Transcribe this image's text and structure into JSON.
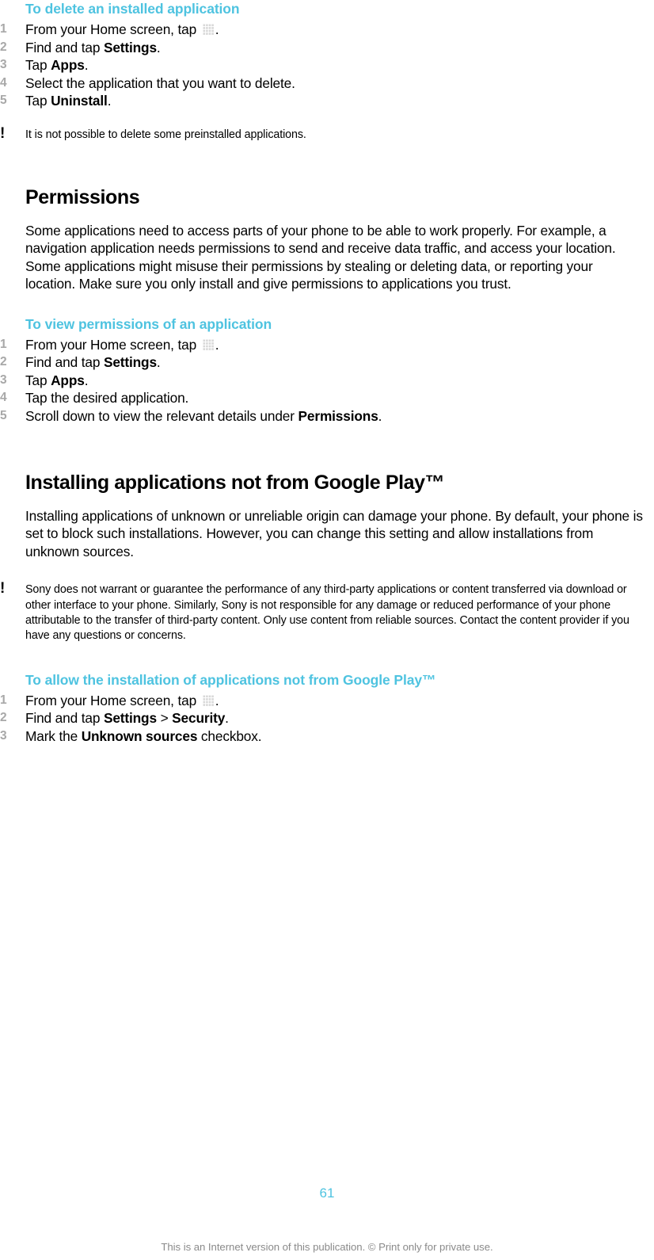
{
  "document": {
    "page_number": "61",
    "footer_note": "This is an Internet version of this publication. © Print only for private use.",
    "accent_color": "#4ec3e0",
    "step_number_color": "#a8a8a8",
    "footer_color": "#8a8a8a"
  },
  "icons": {
    "app_drawer": "app-drawer-grid-icon",
    "warning": "!"
  },
  "sections": {
    "delete_app": {
      "heading": "To delete an installed application",
      "steps": [
        {
          "num": "1",
          "pre": "From your Home screen, tap ",
          "icon": true,
          "post": "."
        },
        {
          "num": "2",
          "pre": "Find and tap ",
          "bold": "Settings",
          "post": "."
        },
        {
          "num": "3",
          "pre": "Tap ",
          "bold": "Apps",
          "post": "."
        },
        {
          "num": "4",
          "pre": "Select the application that you want to delete.",
          "post": ""
        },
        {
          "num": "5",
          "pre": "Tap ",
          "bold": "Uninstall",
          "post": "."
        }
      ],
      "note": "It is not possible to delete some preinstalled applications."
    },
    "permissions": {
      "heading": "Permissions",
      "paragraph": "Some applications need to access parts of your phone to be able to work properly. For example, a navigation application needs permissions to send and receive data traffic, and access your location. Some applications might misuse their permissions by stealing or deleting data, or reporting your location. Make sure you only install and give permissions to applications you trust.",
      "task": {
        "heading": "To view permissions of an application",
        "steps": [
          {
            "num": "1",
            "pre": "From your Home screen, tap ",
            "icon": true,
            "post": "."
          },
          {
            "num": "2",
            "pre": "Find and tap ",
            "bold": "Settings",
            "post": "."
          },
          {
            "num": "3",
            "pre": "Tap ",
            "bold": "Apps",
            "post": "."
          },
          {
            "num": "4",
            "pre": "Tap the desired application.",
            "post": ""
          },
          {
            "num": "5",
            "pre": "Scroll down to view the relevant details under ",
            "bold": "Permissions",
            "post": "."
          }
        ]
      }
    },
    "installing_not_google_play": {
      "heading": "Installing applications not from Google Play™",
      "paragraph": "Installing applications of unknown or unreliable origin can damage your phone. By default, your phone is set to block such installations. However, you can change this setting and allow installations from unknown sources.",
      "note": "Sony does not warrant or guarantee the performance of any third-party applications or content transferred via download or other interface to your phone. Similarly, Sony is not responsible for any damage or reduced performance of your phone attributable to the transfer of third-party content. Only use content from reliable sources. Contact the content provider if you have any questions or concerns.",
      "task": {
        "heading": "To allow the installation of applications not from Google Play™",
        "steps": [
          {
            "num": "1",
            "pre": "From your Home screen, tap ",
            "icon": true,
            "post": "."
          },
          {
            "num": "2",
            "pre": "Find and tap ",
            "bold": "Settings",
            "sep": " > ",
            "bold2": "Security",
            "post": "."
          },
          {
            "num": "3",
            "pre": "Mark the ",
            "bold": "Unknown sources",
            "post": " checkbox."
          }
        ]
      }
    }
  }
}
